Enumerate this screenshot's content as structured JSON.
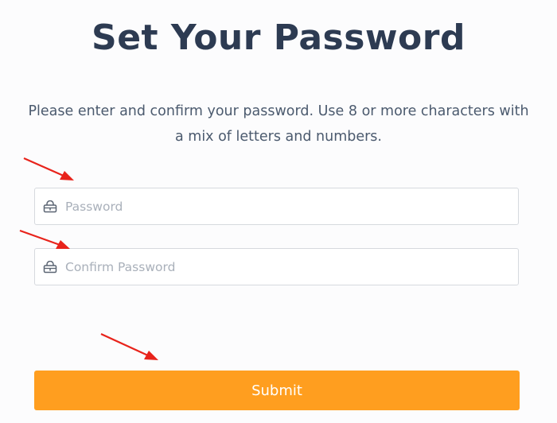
{
  "header": {
    "title": "Set Your Password",
    "subtitle": "Please enter and confirm your password. Use 8 or more characters with a mix of letters and numbers."
  },
  "form": {
    "password_placeholder": "Password",
    "confirm_placeholder": "Confirm Password",
    "submit_label": "Submit"
  },
  "icons": {
    "field_icon": "lock-icon",
    "annotation": "red-arrow-icon"
  },
  "colors": {
    "title": "#2d3b52",
    "submit_bg": "#ff9e1f",
    "annotation_arrow": "#e8231b"
  }
}
